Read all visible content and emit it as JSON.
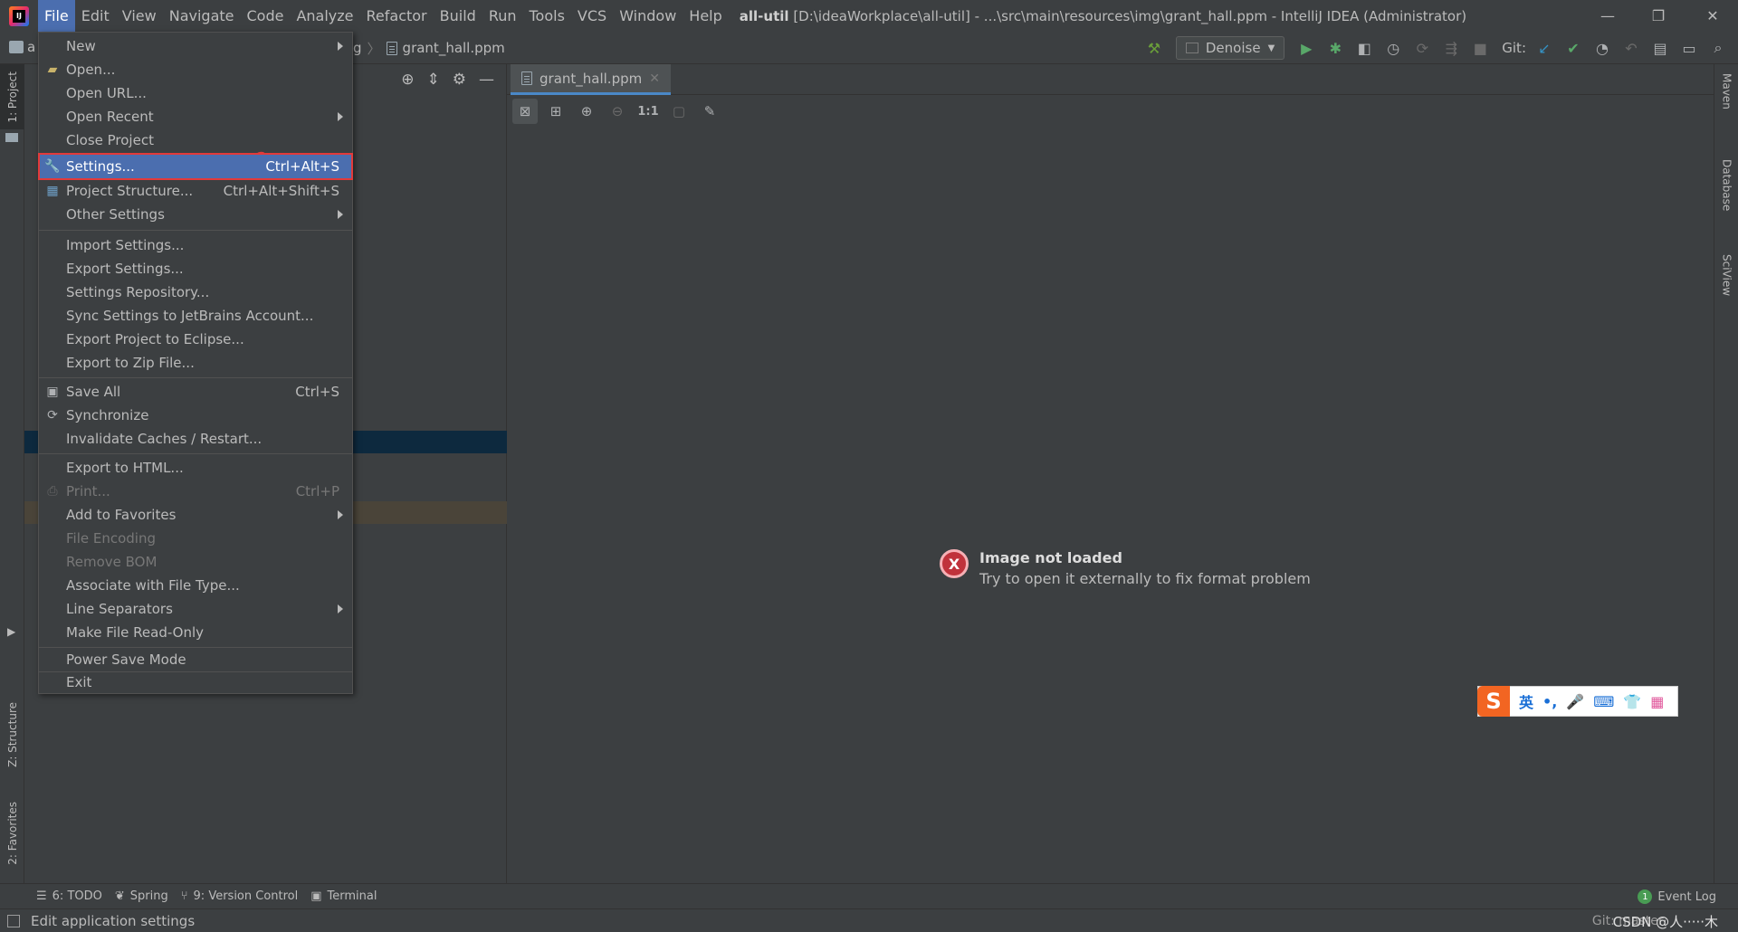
{
  "menubar": {
    "items": [
      "File",
      "Edit",
      "View",
      "Navigate",
      "Code",
      "Analyze",
      "Refactor",
      "Build",
      "Run",
      "Tools",
      "VCS",
      "Window",
      "Help"
    ],
    "active": "File",
    "window_title_bold": "all-util",
    "window_title_rest": "[D:\\ideaWorkplace\\all-util] - ...\\src\\main\\resources\\img\\grant_hall.ppm - IntelliJ IDEA (Administrator)"
  },
  "window_controls": {
    "minimize": "—",
    "restore": "❐",
    "close": "✕"
  },
  "navbar": {
    "breadcrumb_fragment": "g",
    "breadcrumb_file": "grant_hall.ppm",
    "project_fragment": "a",
    "run_config": "Denoise",
    "git_label": "Git:"
  },
  "left_stripe": {
    "project_tab": "1: Project",
    "structure_tab": "Z: Structure",
    "favorites_tab": "2: Favorites"
  },
  "right_stripe": {
    "maven_tab": "Maven",
    "database_tab": "Database",
    "sciview_tab": "SciView"
  },
  "editor": {
    "tab_label": "grant_hall.ppm",
    "zoom_actual": "1:1",
    "error_title": "Image not loaded",
    "error_sub": "Try to open it externally to fix format problem"
  },
  "file_menu": {
    "annotation": "2",
    "items": [
      {
        "label": "New",
        "shortcut": "",
        "submenu": true,
        "icon": ""
      },
      {
        "label": "Open...",
        "shortcut": "",
        "submenu": false,
        "icon": "folder-icon"
      },
      {
        "label": "Open URL...",
        "shortcut": "",
        "submenu": false,
        "icon": ""
      },
      {
        "label": "Open Recent",
        "shortcut": "",
        "submenu": true,
        "icon": ""
      },
      {
        "label": "Close Project",
        "shortcut": "",
        "submenu": false,
        "icon": ""
      },
      {
        "label": "Settings...",
        "shortcut": "Ctrl+Alt+S",
        "submenu": false,
        "icon": "wrench-icon"
      },
      {
        "label": "Project Structure...",
        "shortcut": "Ctrl+Alt+Shift+S",
        "submenu": false,
        "icon": "project-structure-icon"
      },
      {
        "label": "Other Settings",
        "shortcut": "",
        "submenu": true,
        "icon": ""
      },
      {
        "label": "Import Settings...",
        "shortcut": "",
        "submenu": false,
        "icon": ""
      },
      {
        "label": "Export Settings...",
        "shortcut": "",
        "submenu": false,
        "icon": ""
      },
      {
        "label": "Settings Repository...",
        "shortcut": "",
        "submenu": false,
        "icon": ""
      },
      {
        "label": "Sync Settings to JetBrains Account...",
        "shortcut": "",
        "submenu": false,
        "icon": ""
      },
      {
        "label": "Export Project to Eclipse...",
        "shortcut": "",
        "submenu": false,
        "icon": ""
      },
      {
        "label": "Export to Zip File...",
        "shortcut": "",
        "submenu": false,
        "icon": ""
      },
      {
        "label": "Save All",
        "shortcut": "Ctrl+S",
        "submenu": false,
        "icon": "save-icon"
      },
      {
        "label": "Synchronize",
        "shortcut": "",
        "submenu": false,
        "icon": "sync-icon"
      },
      {
        "label": "Invalidate Caches / Restart...",
        "shortcut": "",
        "submenu": false,
        "icon": ""
      },
      {
        "label": "Export to HTML...",
        "shortcut": "",
        "submenu": false,
        "icon": ""
      },
      {
        "label": "Print...",
        "shortcut": "Ctrl+P",
        "submenu": false,
        "icon": "print-icon",
        "disabled": true
      },
      {
        "label": "Add to Favorites",
        "shortcut": "",
        "submenu": true,
        "icon": ""
      },
      {
        "label": "File Encoding",
        "shortcut": "",
        "submenu": false,
        "icon": "",
        "disabled": true
      },
      {
        "label": "Remove BOM",
        "shortcut": "",
        "submenu": false,
        "icon": "",
        "disabled": true
      },
      {
        "label": "Associate with File Type...",
        "shortcut": "",
        "submenu": false,
        "icon": ""
      },
      {
        "label": "Line Separators",
        "shortcut": "",
        "submenu": true,
        "icon": ""
      },
      {
        "label": "Make File Read-Only",
        "shortcut": "",
        "submenu": false,
        "icon": ""
      },
      {
        "label": "Power Save Mode",
        "shortcut": "",
        "submenu": false,
        "icon": ""
      },
      {
        "label": "Exit",
        "shortcut": "",
        "submenu": false,
        "icon": ""
      }
    ]
  },
  "ime": {
    "logo": "S",
    "mode": "英",
    "punct": "•,",
    "mic": "🎤",
    "keyboard": "⌨",
    "skin": "👕",
    "apps": "▦"
  },
  "bottom_bar": {
    "todo": "6: TODO",
    "spring": "Spring",
    "vcs": "9: Version Control",
    "terminal": "Terminal",
    "event_log": "Event Log",
    "event_count": "1"
  },
  "status_bar": {
    "text": "Edit application settings",
    "git_branch": "Git: master",
    "watermark": "CSDN @人·····木"
  },
  "colors": {
    "highlight": "#4b6eaf",
    "annotation_red": "#e33a3a",
    "background": "#3c3f41",
    "error_red": "#c0323b"
  }
}
